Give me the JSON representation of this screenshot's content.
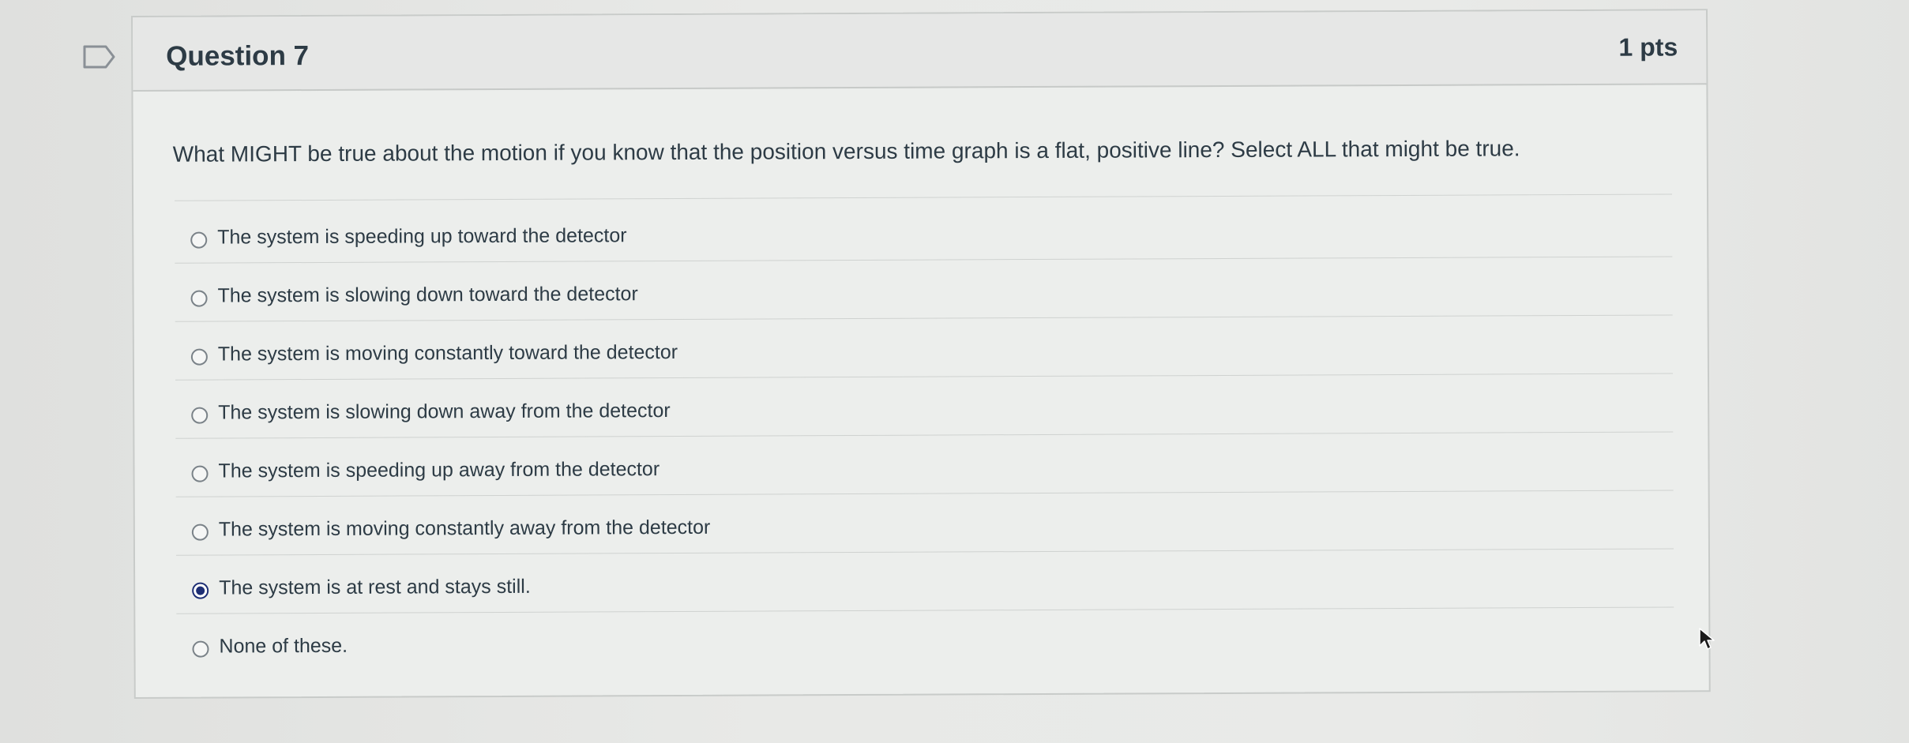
{
  "question": {
    "title": "Question 7",
    "points": "1 pts",
    "text": "What MIGHT be true about the motion if you know that the position versus time graph is a flat, positive line? Select ALL that might be true.",
    "answers": [
      {
        "label": "The system is speeding up toward the detector",
        "selected": false
      },
      {
        "label": "The system is slowing down toward the detector",
        "selected": false
      },
      {
        "label": "The system is moving constantly toward the detector",
        "selected": false
      },
      {
        "label": "The system is slowing down away from the detector",
        "selected": false
      },
      {
        "label": "The system is speeding up away from the detector",
        "selected": false
      },
      {
        "label": "The system is moving constantly away from the detector",
        "selected": false
      },
      {
        "label": "The system is at rest and stays still.",
        "selected": true
      },
      {
        "label": "None of these.",
        "selected": false
      }
    ]
  },
  "icons": {
    "bookmark": "bookmark-flag-icon",
    "cursor": "mouse-pointer-icon"
  },
  "colors": {
    "accent": "#1d2e74",
    "text": "#2d3b45",
    "border": "#c8cbc9"
  }
}
